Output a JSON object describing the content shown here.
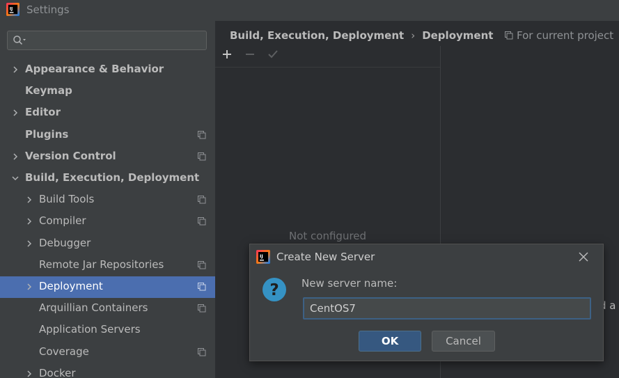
{
  "window": {
    "title": "Settings",
    "app_icon": "intellij-idea-icon"
  },
  "search": {
    "value": "",
    "placeholder": ""
  },
  "tree": [
    {
      "label": "Appearance & Behavior",
      "level": 0,
      "bold": true,
      "expandable": true,
      "expanded": false,
      "project_icon": false,
      "selected": false
    },
    {
      "label": "Keymap",
      "level": 0,
      "bold": true,
      "expandable": false,
      "expanded": false,
      "project_icon": false,
      "selected": false
    },
    {
      "label": "Editor",
      "level": 0,
      "bold": true,
      "expandable": true,
      "expanded": false,
      "project_icon": false,
      "selected": false
    },
    {
      "label": "Plugins",
      "level": 0,
      "bold": true,
      "expandable": false,
      "expanded": false,
      "project_icon": true,
      "selected": false
    },
    {
      "label": "Version Control",
      "level": 0,
      "bold": true,
      "expandable": true,
      "expanded": false,
      "project_icon": true,
      "selected": false
    },
    {
      "label": "Build, Execution, Deployment",
      "level": 0,
      "bold": true,
      "expandable": true,
      "expanded": true,
      "project_icon": false,
      "selected": false
    },
    {
      "label": "Build Tools",
      "level": 1,
      "bold": false,
      "expandable": true,
      "expanded": false,
      "project_icon": true,
      "selected": false
    },
    {
      "label": "Compiler",
      "level": 1,
      "bold": false,
      "expandable": true,
      "expanded": false,
      "project_icon": true,
      "selected": false
    },
    {
      "label": "Debugger",
      "level": 1,
      "bold": false,
      "expandable": true,
      "expanded": false,
      "project_icon": false,
      "selected": false
    },
    {
      "label": "Remote Jar Repositories",
      "level": 1,
      "bold": false,
      "expandable": false,
      "expanded": false,
      "project_icon": true,
      "selected": false
    },
    {
      "label": "Deployment",
      "level": 1,
      "bold": false,
      "expandable": true,
      "expanded": false,
      "project_icon": true,
      "selected": true
    },
    {
      "label": "Arquillian Containers",
      "level": 1,
      "bold": false,
      "expandable": false,
      "expanded": false,
      "project_icon": true,
      "selected": false
    },
    {
      "label": "Application Servers",
      "level": 1,
      "bold": false,
      "expandable": false,
      "expanded": false,
      "project_icon": false,
      "selected": false
    },
    {
      "label": "Coverage",
      "level": 1,
      "bold": false,
      "expandable": false,
      "expanded": false,
      "project_icon": true,
      "selected": false
    },
    {
      "label": "Docker",
      "level": 1,
      "bold": false,
      "expandable": true,
      "expanded": false,
      "project_icon": false,
      "selected": false
    }
  ],
  "breadcrumb": {
    "parent": "Build, Execution, Deployment",
    "separator": "›",
    "current": "Deployment"
  },
  "scope_label": "For current project",
  "toolbar": {
    "add_icon": "plus-icon",
    "remove_icon": "minus-icon",
    "apply_icon": "checkmark-icon"
  },
  "server_list": {
    "empty_text": "Not configured"
  },
  "right_pane": {
    "clipped_text": "d a"
  },
  "dialog": {
    "title": "Create New Server",
    "field_label": "New server name:",
    "field_value": "CentOS7",
    "ok_label": "OK",
    "cancel_label": "Cancel"
  },
  "colors": {
    "selection": "#4b6eaf",
    "accent_ok": "#365880",
    "question_icon": "#3592c4"
  }
}
